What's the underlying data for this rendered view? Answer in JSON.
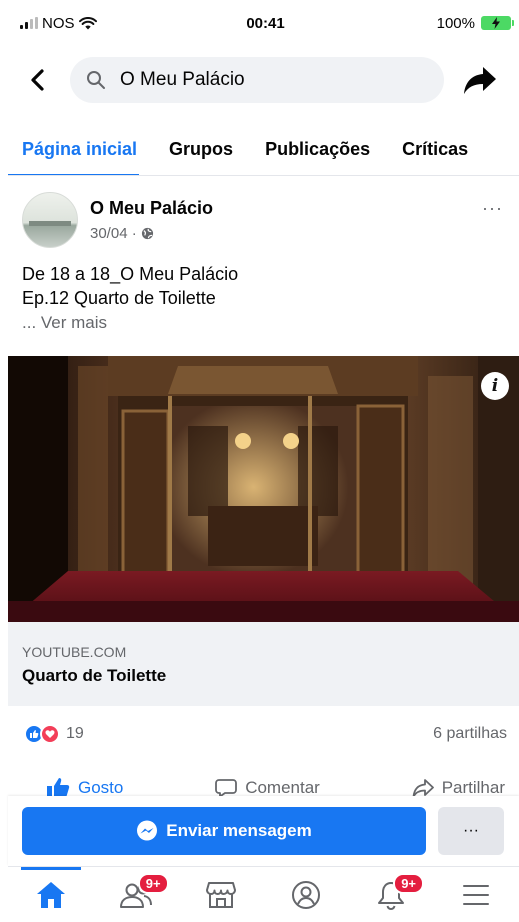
{
  "status_bar": {
    "carrier": "NOS",
    "time": "00:41",
    "battery": "100%"
  },
  "search": {
    "query": "O Meu Palácio"
  },
  "tabs": [
    {
      "label": "Página inicial",
      "active": true
    },
    {
      "label": "Grupos",
      "active": false
    },
    {
      "label": "Publicações",
      "active": false
    },
    {
      "label": "Críticas",
      "active": false
    }
  ],
  "post": {
    "author": "O Meu Palácio",
    "date": "30/04 ·",
    "text_line1": "De 18 a 18_O Meu Palácio",
    "text_line2": "Ep.12 Quarto de Toilette",
    "see_more": "... Ver mais",
    "more_label": "···"
  },
  "image": {
    "info_label": "i"
  },
  "link": {
    "domain": "YOUTUBE.COM",
    "title": "Quarto de Toilette"
  },
  "stats": {
    "reaction_count": "19",
    "shares": "6 partilhas"
  },
  "actions": {
    "like": "Gosto",
    "comment": "Comentar",
    "share": "Partilhar"
  },
  "message_bar": {
    "send_label": "Enviar mensagem",
    "more_label": "···"
  },
  "bottom_nav": {
    "friends_badge": "9+",
    "notifications_badge": "9+"
  },
  "colors": {
    "accent": "#1877f2",
    "badge": "#e41e3f",
    "love": "#f33e58"
  }
}
